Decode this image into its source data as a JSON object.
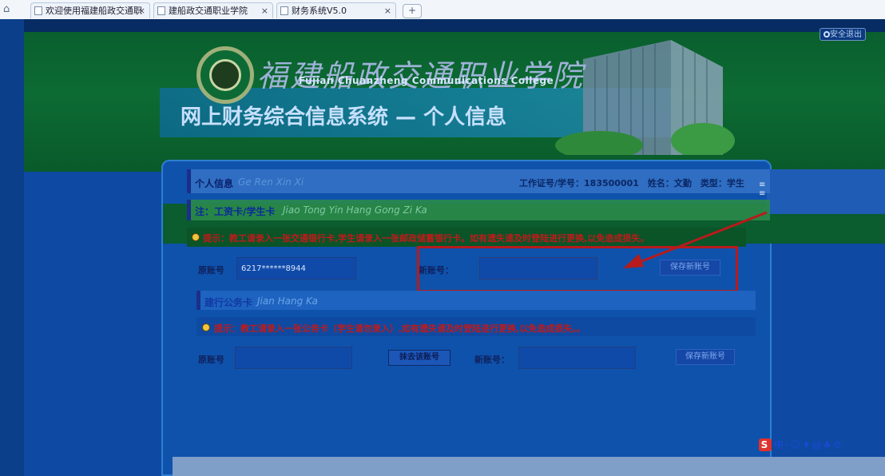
{
  "browser": {
    "tabs": [
      {
        "label": "欢迎使用福建船政交通职"
      },
      {
        "label": "建船政交通职业学院"
      },
      {
        "label": "财务系统V5.0"
      }
    ],
    "new_tab": "+"
  },
  "header": {
    "college_cn": "福建船政交通职业学院",
    "college_en": "Fujian Chuanzheng Communications College",
    "system_title": "网上财务综合信息系统 — 个人信息",
    "logout": "安全退出"
  },
  "profile": {
    "section_label": "个人信息",
    "section_pinyin": "Ge Ren Xin Xi",
    "info": "工作证号/学号：183500001　姓名：文勤　类型：学生"
  },
  "salary_card": {
    "section_label": "注：工资卡/学生卡",
    "section_pinyin": "Jiao Tong Yin Hang Gong Zi Ka",
    "notice": "提示：教工请录入一张交通银行卡,学生请录入一张邮政储蓄银行卡。如有遗失请及时登陆进行更换,以免造成损失。",
    "old_label": "原账号",
    "old_value": "6217******8944",
    "new_label": "新账号：",
    "new_value": "",
    "save_btn": "保存新账号"
  },
  "official_card": {
    "section_label": "建行公务卡",
    "section_pinyin": "Jian Hang Ka",
    "notice": "提示：教工请录入一张公务卡（学生请勿录入）,如有遗失请及时登陆进行更换,以免造成损失。。",
    "old_label": "原账号",
    "old_value": "",
    "clear_btn": "抹去该账号",
    "new_label": "新账号：",
    "new_value": "",
    "save_btn": "保存新账号"
  },
  "ime": {
    "logo": "S",
    "mode": "中"
  },
  "colors": {
    "alert": "#c01a1a",
    "highlight_box": "#b81b1b"
  }
}
